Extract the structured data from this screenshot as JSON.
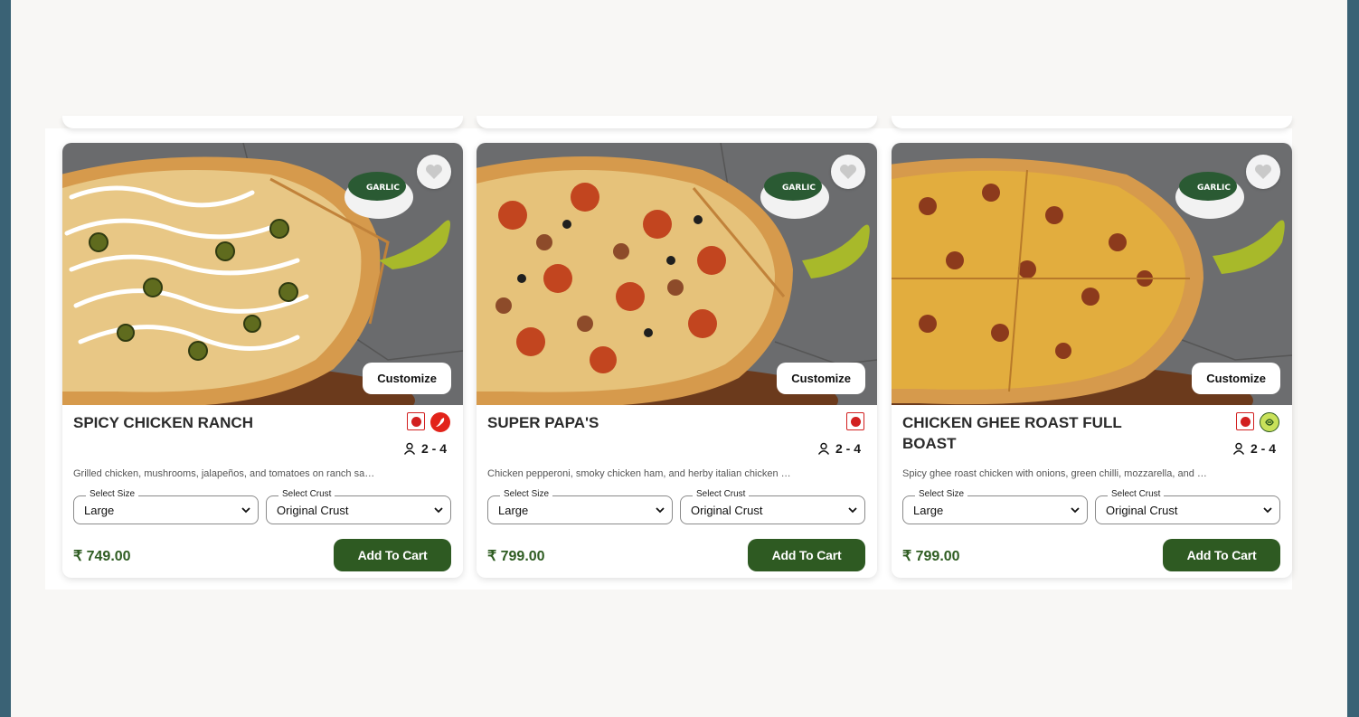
{
  "colors": {
    "accent": "#2e5a22",
    "price": "#2f5d22",
    "nonveg": "#d21f1f"
  },
  "products": [
    {
      "name": "SPICY CHICKEN RANCH",
      "badges": [
        "non-veg-icon",
        "spicy-chili-icon"
      ],
      "serves": "2 - 4",
      "description": "Grilled chicken, mushrooms, jalapeños, and tomatoes on ranch sauce and...",
      "size_label": "Select Size",
      "size_value": "Large",
      "crust_label": "Select Crust",
      "crust_value": "Original Crust",
      "price": "₹ 749.00",
      "customize_label": "Customize",
      "cart_label": "Add To Cart"
    },
    {
      "name": "SUPER PAPA'S",
      "badges": [
        "non-veg-icon"
      ],
      "serves": "2 - 4",
      "description": "Chicken pepperoni, smoky chicken ham, and herby italian chicken sausage with...",
      "size_label": "Select Size",
      "size_value": "Large",
      "crust_label": "Select Crust",
      "crust_value": "Original Crust",
      "price": "₹ 799.00",
      "customize_label": "Customize",
      "cart_label": "Add To Cart"
    },
    {
      "name": "CHICKEN GHEE ROAST FULL BOAST",
      "badges": [
        "non-veg-icon",
        "special-icon"
      ],
      "serves": "2 - 4",
      "description": "Spicy ghee roast chicken with onions, green chilli, mozzarella, and rich ghee roast...",
      "size_label": "Select Size",
      "size_value": "Large",
      "crust_label": "Select Crust",
      "crust_value": "Original Crust",
      "price": "₹ 799.00",
      "customize_label": "Customize",
      "cart_label": "Add To Cart"
    }
  ]
}
